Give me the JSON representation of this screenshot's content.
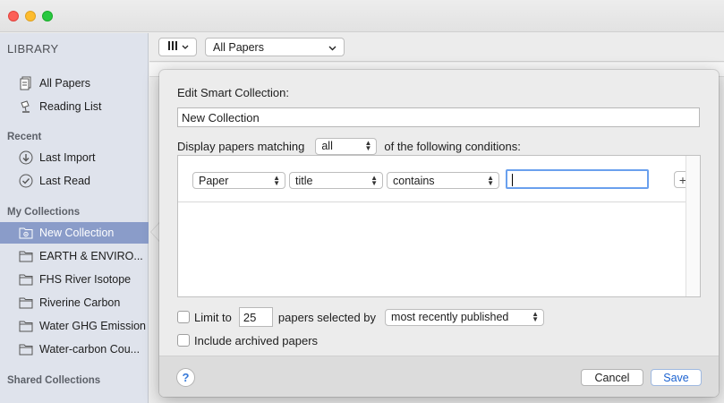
{
  "sidebar": {
    "library_heading": "LIBRARY",
    "library_items": [
      {
        "label": "All Papers",
        "icon": "papers-icon"
      },
      {
        "label": "Reading List",
        "icon": "reading-lamp-icon"
      }
    ],
    "recent_heading": "Recent",
    "recent_items": [
      {
        "label": "Last Import",
        "icon": "import-arrow-icon"
      },
      {
        "label": "Last Read",
        "icon": "checkmark-circle-icon"
      }
    ],
    "collections_heading": "My Collections",
    "collections": [
      {
        "label": "New Collection",
        "icon": "smart-folder-icon",
        "selected": true
      },
      {
        "label": "EARTH & ENVIRO...",
        "icon": "folder-icon"
      },
      {
        "label": "FHS River Isotope",
        "icon": "folder-icon"
      },
      {
        "label": "Riverine Carbon",
        "icon": "folder-icon"
      },
      {
        "label": "Water GHG Emission",
        "icon": "folder-icon"
      },
      {
        "label": "Water-carbon Cou...",
        "icon": "folder-icon"
      }
    ],
    "shared_heading": "Shared Collections"
  },
  "toolbar": {
    "view_selector": "All Papers"
  },
  "dialog": {
    "title": "Edit Smart Collection:",
    "collection_name": "New Collection",
    "match_prefix": "Display papers matching",
    "match_mode": "all",
    "match_suffix": "of the following conditions:",
    "condition": {
      "scope": "Paper",
      "field": "title",
      "operator": "contains",
      "value": ""
    },
    "add_label": "+",
    "limit_label": "Limit to",
    "limit_checked": false,
    "limit_count": "25",
    "selected_by_label": "papers selected by",
    "selected_by": "most recently published",
    "archived_label": "Include archived papers",
    "archived_checked": false,
    "help_label": "?",
    "cancel_label": "Cancel",
    "save_label": "Save"
  },
  "colors": {
    "sidebar_bg": "#dfe3ec",
    "selection": "#8a9cc9",
    "accent": "#1b62d0",
    "focus_ring": "#6aa0ee"
  }
}
